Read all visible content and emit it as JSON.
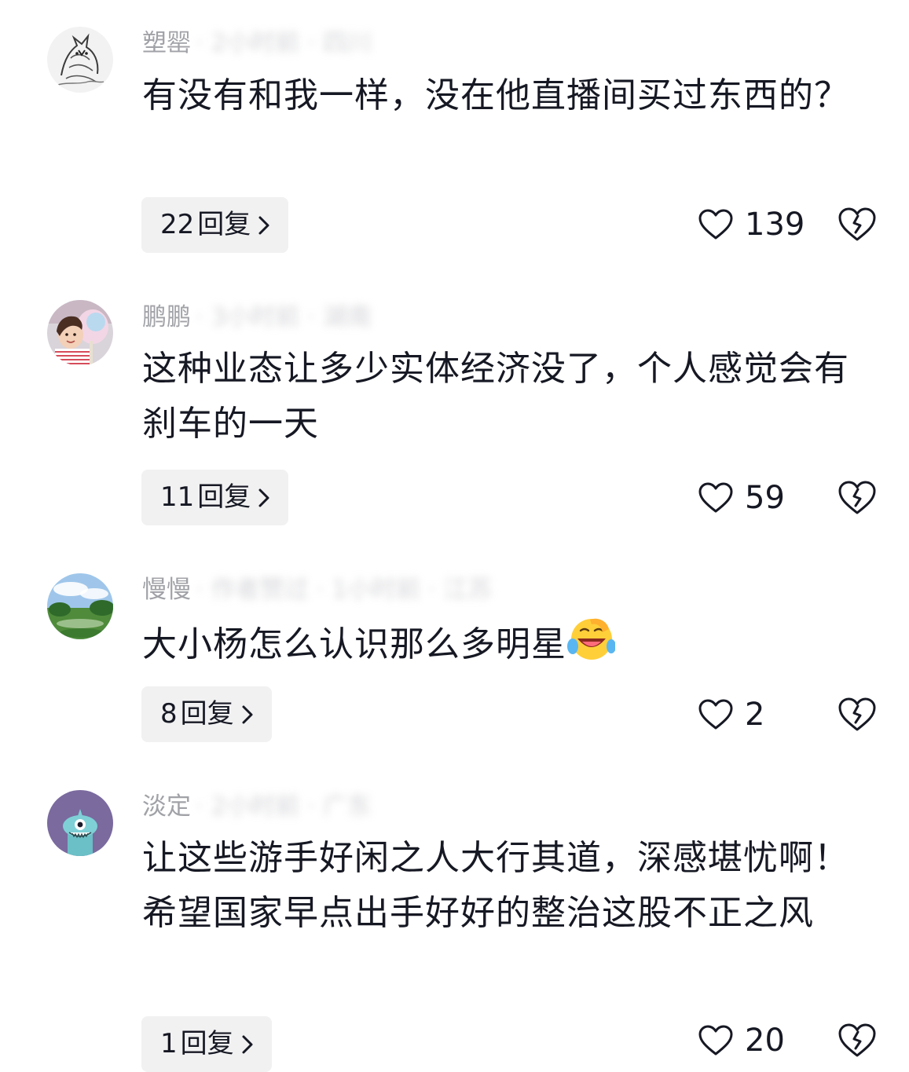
{
  "comments": [
    {
      "username": "塑罂",
      "meta_obscured": "· 2小时前 · 四川",
      "text": "有没有和我一样，没在他直播间买过东西的？",
      "reply_count": "22",
      "reply_label": "回复",
      "likes": "139",
      "avatar_icon": "ink-wolf-avatar-icon"
    },
    {
      "username": "鹏鹏",
      "meta_obscured": "· 3小时前 · 湖南",
      "text": "这种业态让多少实体经济没了，个人感觉会有刹车的一天",
      "reply_count": "11",
      "reply_label": "回复",
      "likes": "59",
      "avatar_icon": "girl-cotton-candy-avatar-icon"
    },
    {
      "username": "慢慢",
      "meta_obscured": "· 作者赞过 · 1小时前 · 江苏",
      "text": "大小杨怎么认识那么多明星",
      "text_emoji": "laughing-crying-emoji",
      "reply_count": "8",
      "reply_label": "回复",
      "likes": "2",
      "avatar_icon": "park-landscape-avatar-icon"
    },
    {
      "username": "淡定",
      "meta_obscured": "· 2小时前 · 广东",
      "text": "让这些游手好闲之人大行其道，深感堪忧啊！希望国家早点出手好好的整治这股不正之风",
      "reply_count": "1",
      "reply_label": "回复",
      "likes": "20",
      "avatar_icon": "cartoon-monster-avatar-icon"
    }
  ],
  "colors": {
    "text_primary": "#161823",
    "text_secondary": "#a1a2a7",
    "reply_button_bg": "#f1f1f2"
  }
}
